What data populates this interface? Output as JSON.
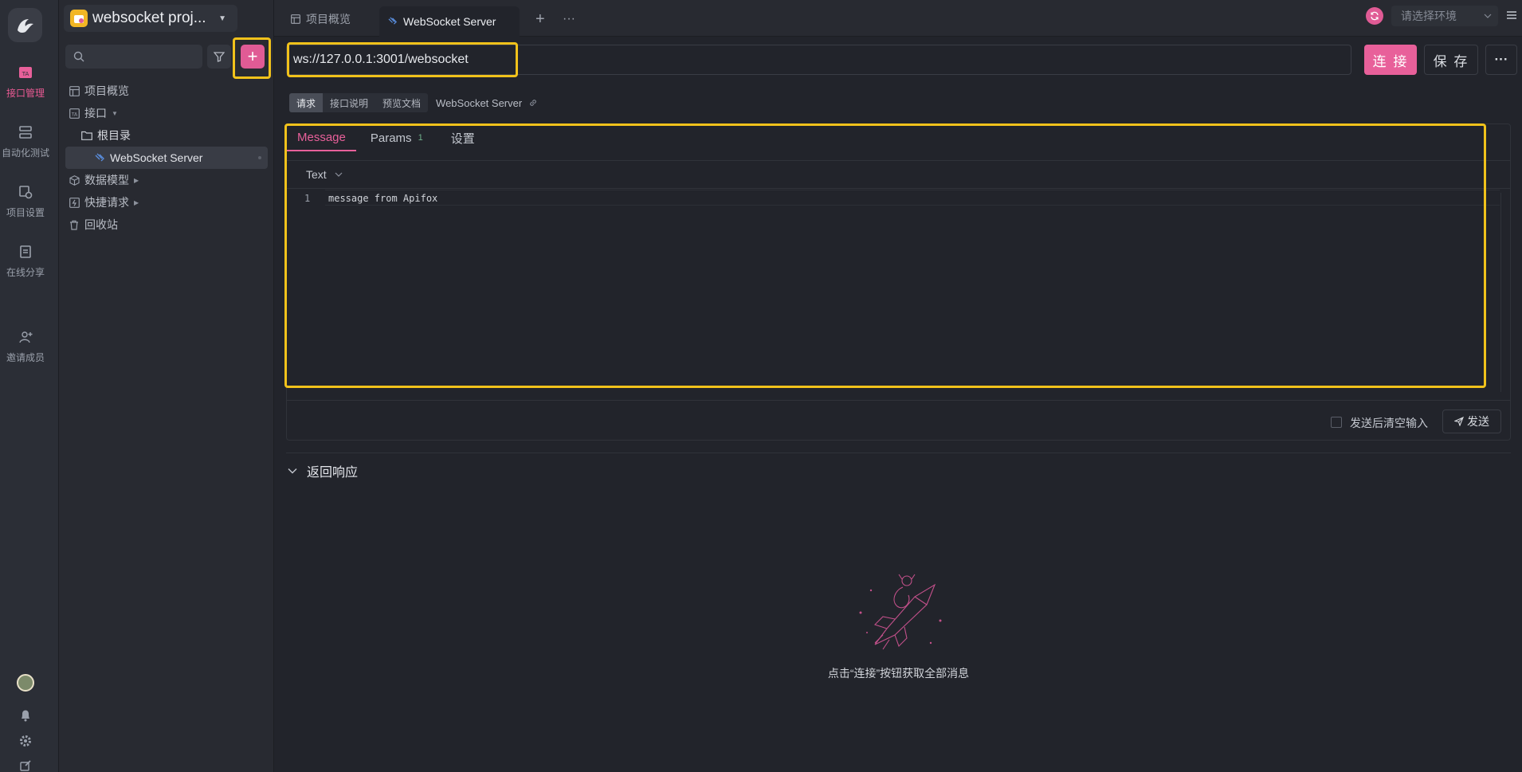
{
  "rail": {
    "items": [
      {
        "label": "接口管理",
        "icon": "api-management-icon",
        "active": true
      },
      {
        "label": "自动化测试",
        "icon": "automation-test-icon",
        "active": false
      },
      {
        "label": "项目设置",
        "icon": "project-settings-icon",
        "active": false
      },
      {
        "label": "在线分享",
        "icon": "online-share-icon",
        "active": false
      },
      {
        "label": "邀请成员",
        "icon": "invite-member-icon",
        "active": false
      }
    ]
  },
  "sidebar": {
    "project_name": "websocket proj...",
    "search_placeholder": "",
    "tree": [
      {
        "label": "项目概览",
        "icon": "layout-icon"
      },
      {
        "label": "接口",
        "icon": "api-icon"
      },
      {
        "label": "根目录",
        "icon": "folder-icon"
      },
      {
        "label": "WebSocket Server",
        "icon": "websocket-icon"
      },
      {
        "label": "数据模型",
        "icon": "cube-icon"
      },
      {
        "label": "快捷请求",
        "icon": "quick-request-icon"
      },
      {
        "label": "回收站",
        "icon": "trash-icon"
      }
    ]
  },
  "topbar": {
    "tabs": [
      {
        "label": "项目概览",
        "active": false
      },
      {
        "label": "WebSocket Server",
        "active": true
      }
    ],
    "env_placeholder": "请选择环境"
  },
  "request": {
    "url": "ws://127.0.0.1:3001/websocket",
    "connect_label": "连 接",
    "save_label": "保 存",
    "more_label": "···"
  },
  "subtabs": {
    "items": [
      "请求",
      "接口说明",
      "预览文档"
    ],
    "title": "WebSocket Server"
  },
  "message_panel": {
    "tabs": [
      {
        "label": "Message",
        "active": true,
        "badge": ""
      },
      {
        "label": "Params",
        "active": false,
        "badge": "1"
      },
      {
        "label": "设置",
        "active": false,
        "badge": ""
      }
    ],
    "format": "Text",
    "lines": [
      {
        "num": "1",
        "text": "message from Apifox"
      }
    ],
    "clear_after_send_label": "发送后清空输入",
    "send_label": "发送"
  },
  "response": {
    "title": "返回响应",
    "empty_text": "点击“连接”按钮获取全部消息"
  },
  "colors": {
    "accent": "#e8609a",
    "highlight": "#f1c21b",
    "bg": "#22242b"
  }
}
